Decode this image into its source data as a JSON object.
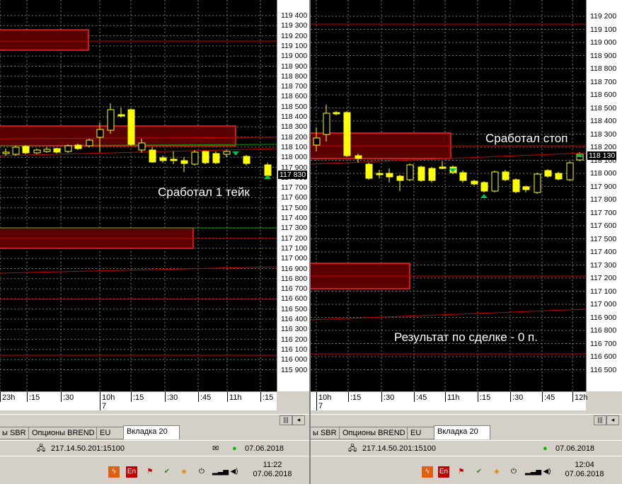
{
  "left_pane": {
    "price_ticks": [
      "119 400",
      "119 300",
      "119 200",
      "119 100",
      "119 000",
      "118 900",
      "118 800",
      "118 700",
      "118 600",
      "118 500",
      "118 400",
      "118 300",
      "118 200",
      "118 100",
      "118 000",
      "117 900",
      "117 800",
      "117 700",
      "117 600",
      "117 500",
      "117 400",
      "117 300",
      "117 200",
      "117 100",
      "117 000",
      "116 900",
      "116 800",
      "116 700",
      "116 600",
      "116 500",
      "116 400",
      "116 300",
      "116 200",
      "116 100",
      "116 000",
      "115 900"
    ],
    "last_price": "117 830",
    "time_ticks": [
      "23h",
      ":15",
      ":30",
      "10h",
      ":15",
      ":30",
      ":45",
      "11h",
      ":15"
    ],
    "date_label": "7",
    "annotation": "Сработал 1 тейк",
    "tabs": [
      "ы SBR",
      "Опционы BREND",
      "EU",
      "Вкладка 20"
    ],
    "active_tab": 3,
    "status_ip": "217.14.50.201:15100",
    "status_date": "07.06.2018",
    "clock_time": "11:22",
    "clock_date": "07.06.2018"
  },
  "right_pane": {
    "price_ticks": [
      "119 200",
      "119 100",
      "119 000",
      "118 900",
      "118 800",
      "118 700",
      "118 600",
      "118 500",
      "118 400",
      "118 300",
      "118 200",
      "118 100",
      "118 000",
      "117 900",
      "117 800",
      "117 700",
      "117 600",
      "117 500",
      "117 400",
      "117 300",
      "117 200",
      "117 100",
      "117 000",
      "116 900",
      "116 800",
      "116 700",
      "116 600",
      "116 500"
    ],
    "last_price": "118 130",
    "time_ticks": [
      "10h",
      ":15",
      ":30",
      ":45",
      "11h",
      ":15",
      ":30",
      ":45",
      "12h"
    ],
    "date_label": "7",
    "annotation_top": "Сработал стоп",
    "annotation_bottom": "Результат по сделке - 0 п.",
    "tabs": [
      "ы SBR",
      "Опционы BREND",
      "EU",
      "Вкладка 20"
    ],
    "active_tab": 3,
    "status_ip": "217.14.50.201:15100",
    "status_date": "07.06.2018",
    "clock_time": "12:04",
    "clock_date": "07.06.2018"
  },
  "icons": {
    "tray": [
      "flame-icon",
      "lang-en-icon",
      "flag-x-icon",
      "shield-check-icon",
      "network-icon",
      "power-plug-icon",
      "signal-icon",
      "speaker-icon"
    ],
    "status": [
      "network-computer-icon",
      "mail-icon",
      "green-dot-icon"
    ]
  },
  "colors": {
    "background": "#000000",
    "bull_candle": "#ffff00",
    "zone_fill": "#5a0000",
    "zone_border": "#ff2020",
    "level_line": "#cc0000",
    "green_line": "#00a000",
    "sell_marker": "#00c050",
    "buy_marker": "#00c050"
  }
}
